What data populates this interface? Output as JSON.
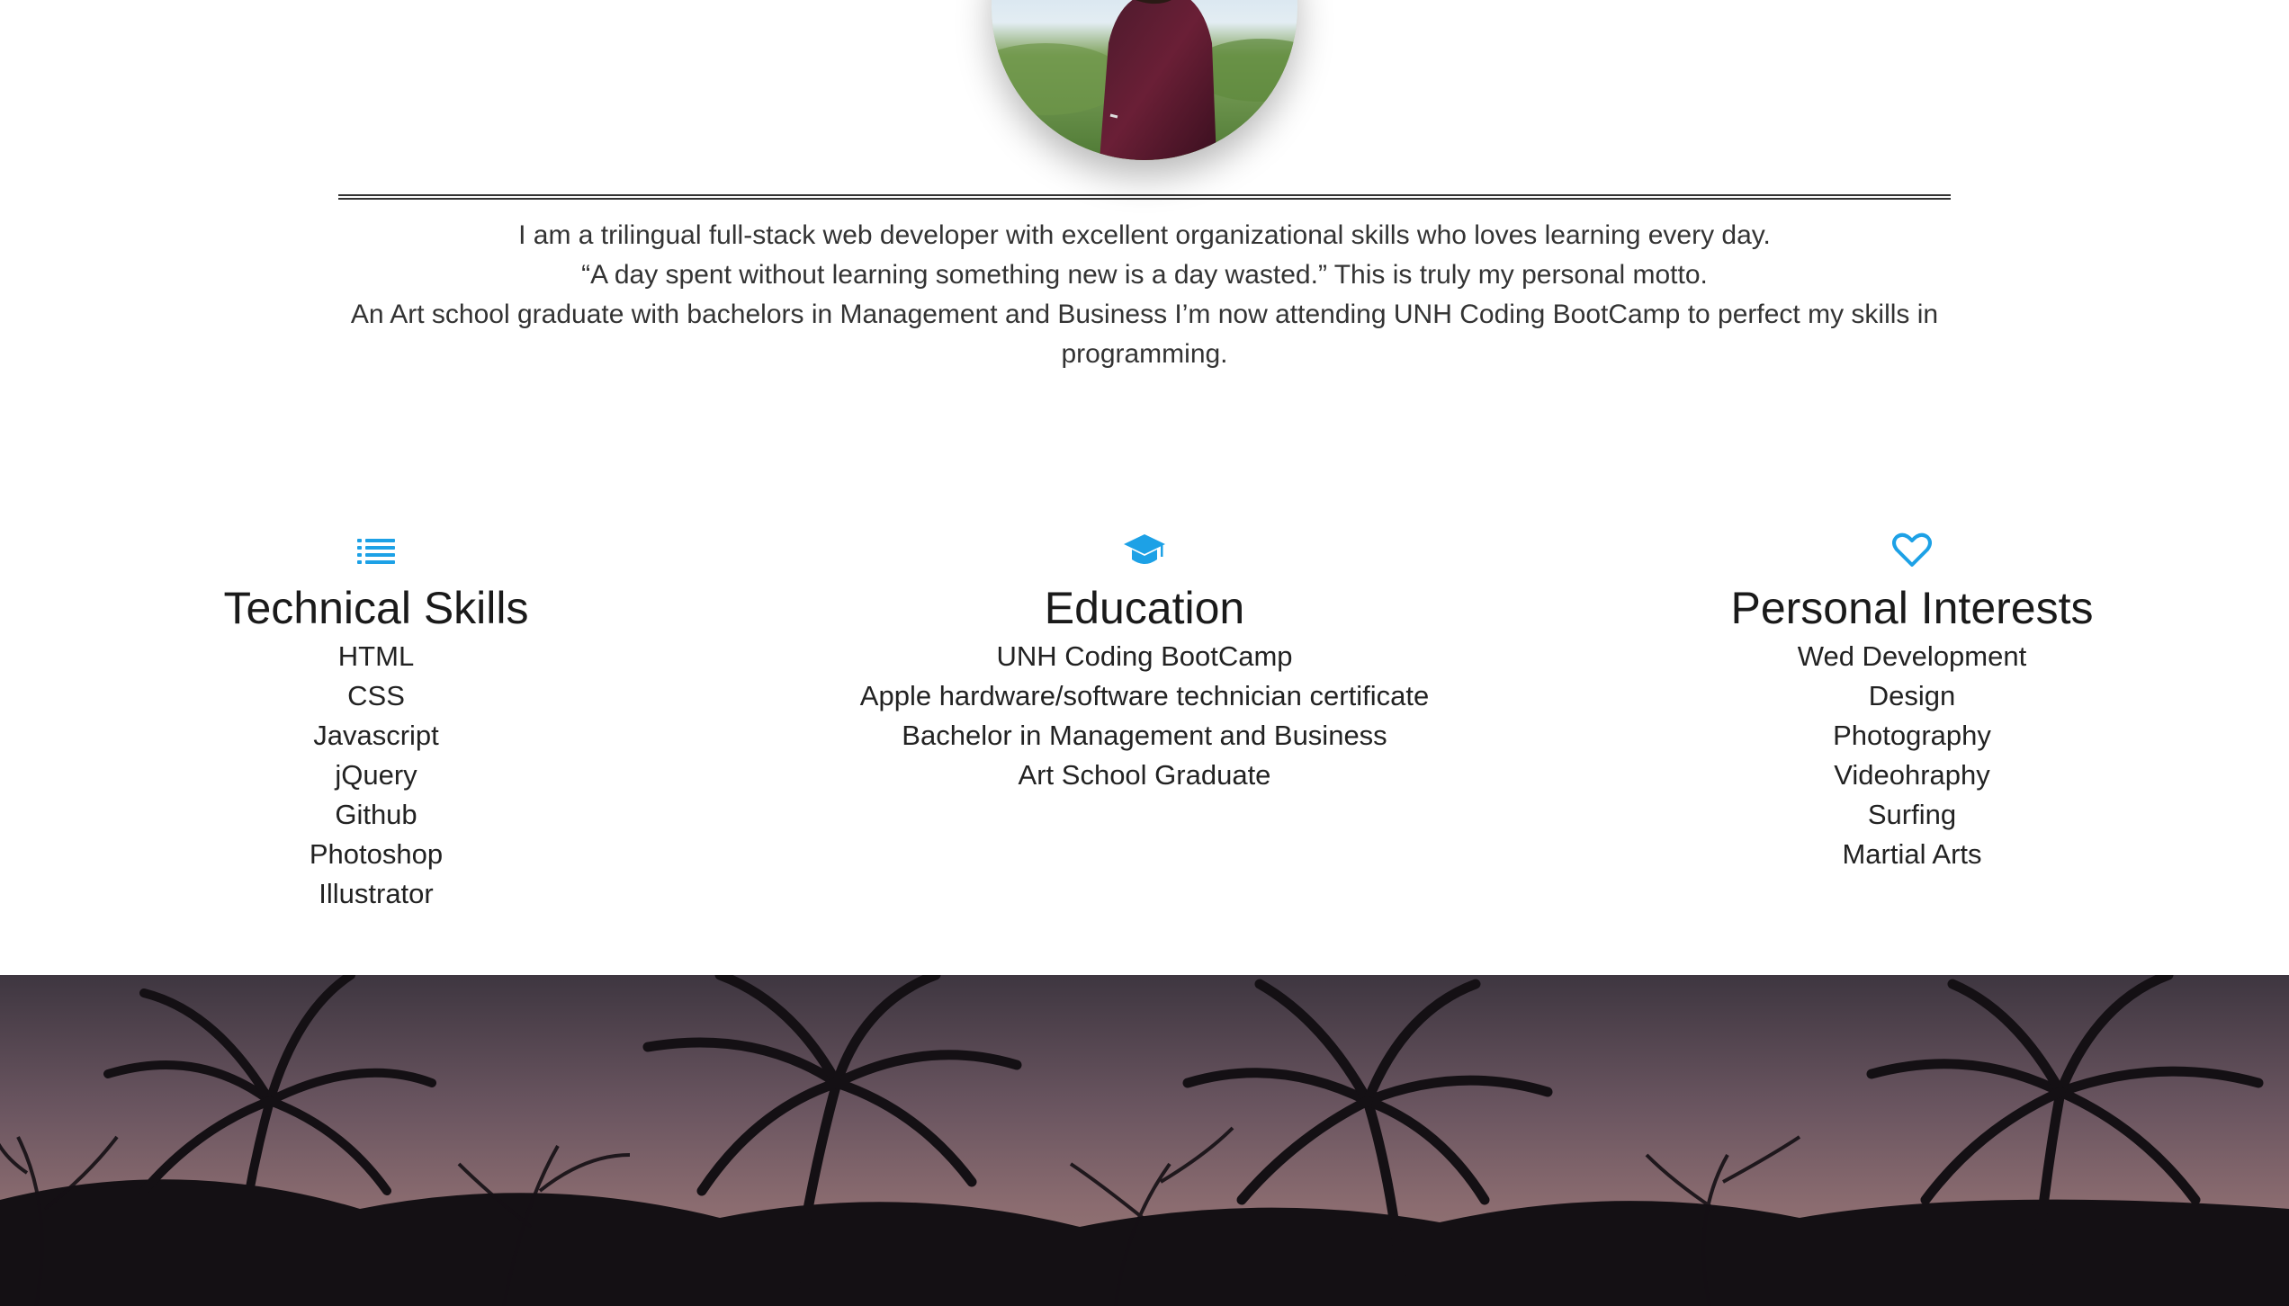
{
  "profile": {
    "avatar_alt": "Profile photo"
  },
  "about": {
    "lines": [
      "I am a trilingual full-stack web developer with excellent organizational skills who loves learning every day.",
      "“A day spent without learning something new is a day wasted.” This is truly my personal motto.",
      "An Art school graduate with bachelors in Management and Business I’m now attending UNH Coding BootCamp to perfect my skills in programming."
    ]
  },
  "sections": {
    "skills": {
      "icon": "list-icon",
      "title": "Technical Skills",
      "items": [
        "HTML",
        "CSS",
        "Javascript",
        "jQuery",
        "Github",
        "Photoshop",
        "Illustrator"
      ]
    },
    "education": {
      "icon": "graduation-cap-icon",
      "title": "Education",
      "items": [
        "UNH Coding BootCamp",
        "Apple hardware/software technician certificate",
        "Bachelor in Management and Business",
        "Art School Graduate"
      ]
    },
    "interests": {
      "icon": "heart-icon",
      "title": "Personal Interests",
      "items": [
        "Wed Development",
        "Design",
        "Photography",
        "Videohraphy",
        "Surfing",
        "Martial Arts"
      ]
    }
  },
  "colors": {
    "accent": "#1da1e6",
    "text": "#333333",
    "heading": "#1a1a1a"
  }
}
